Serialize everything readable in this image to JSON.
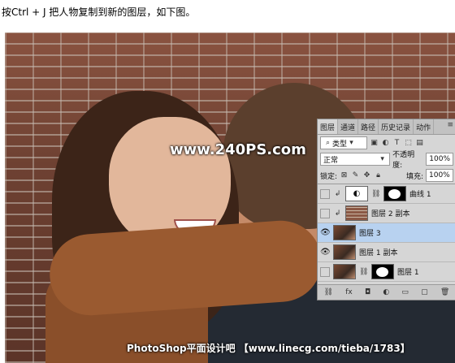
{
  "caption": "按Ctrl + J 把人物复制到新的图层，如下图。",
  "photo": {
    "watermark": "www.240PS.com",
    "footer": "PhotoShop平面设计吧 【www.linecg.com/tieba/1783】"
  },
  "layers_panel": {
    "tabs": [
      "图层",
      "通道",
      "路径",
      "历史记录",
      "动作"
    ],
    "menu_icon": "panel-menu-icon",
    "filter_label": "类型",
    "blend_mode": "正常",
    "opacity_label": "不透明度:",
    "opacity_value": "100%",
    "lock_label": "锁定:",
    "fill_label": "填充:",
    "fill_value": "100%",
    "layers": [
      {
        "name": "曲线 1",
        "visible": false,
        "selected": false,
        "type": "adjustment"
      },
      {
        "name": "图层 2 副本",
        "visible": false,
        "selected": false,
        "type": "brick"
      },
      {
        "name": "图层 3",
        "visible": true,
        "selected": true,
        "type": "photo"
      },
      {
        "name": "图层 1 副本",
        "visible": true,
        "selected": false,
        "type": "photo"
      },
      {
        "name": "图层 1",
        "visible": false,
        "selected": false,
        "type": "photo-mask"
      }
    ]
  }
}
